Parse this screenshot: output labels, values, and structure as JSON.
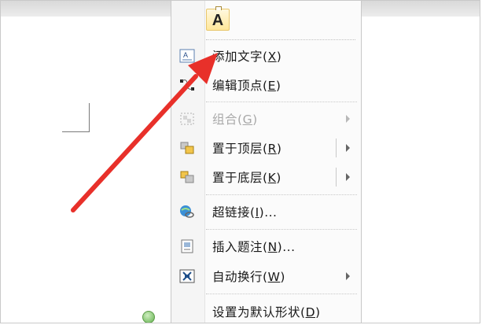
{
  "toolbar_icon": {
    "glyph": "A",
    "icon": "text-box-icon"
  },
  "menu": {
    "items": [
      {
        "pre": "添加文字(",
        "key": "X",
        "post": ")",
        "icon": "add-text-icon",
        "disabled": false,
        "submenu": false
      },
      {
        "pre": "编辑顶点(",
        "key": "E",
        "post": ")",
        "icon": "edit-points-icon",
        "disabled": false,
        "submenu": false
      },
      {
        "pre": "组合(",
        "key": "G",
        "post": ")",
        "icon": "group-icon",
        "disabled": true,
        "submenu": true
      },
      {
        "pre": "置于顶层(",
        "key": "R",
        "post": ")",
        "icon": "bring-to-front-icon",
        "disabled": false,
        "submenu": true
      },
      {
        "pre": "置于底层(",
        "key": "K",
        "post": ")",
        "icon": "send-to-back-icon",
        "disabled": false,
        "submenu": true
      },
      {
        "pre": "超链接(",
        "key": "I",
        "post": ")...",
        "icon": "hyperlink-icon",
        "disabled": false,
        "submenu": false
      },
      {
        "pre": "插入题注(",
        "key": "N",
        "post": ")...",
        "icon": "insert-caption-icon",
        "disabled": false,
        "submenu": false
      },
      {
        "pre": "自动换行(",
        "key": "W",
        "post": ")",
        "icon": "text-wrap-icon",
        "disabled": false,
        "submenu": true
      },
      {
        "pre": "设置为默认形状(",
        "key": "D",
        "post": ")",
        "icon": "",
        "disabled": false,
        "submenu": false
      }
    ]
  },
  "colors": {
    "annotation_arrow": "#e8302a",
    "accent_gold": "#ffe79a"
  }
}
